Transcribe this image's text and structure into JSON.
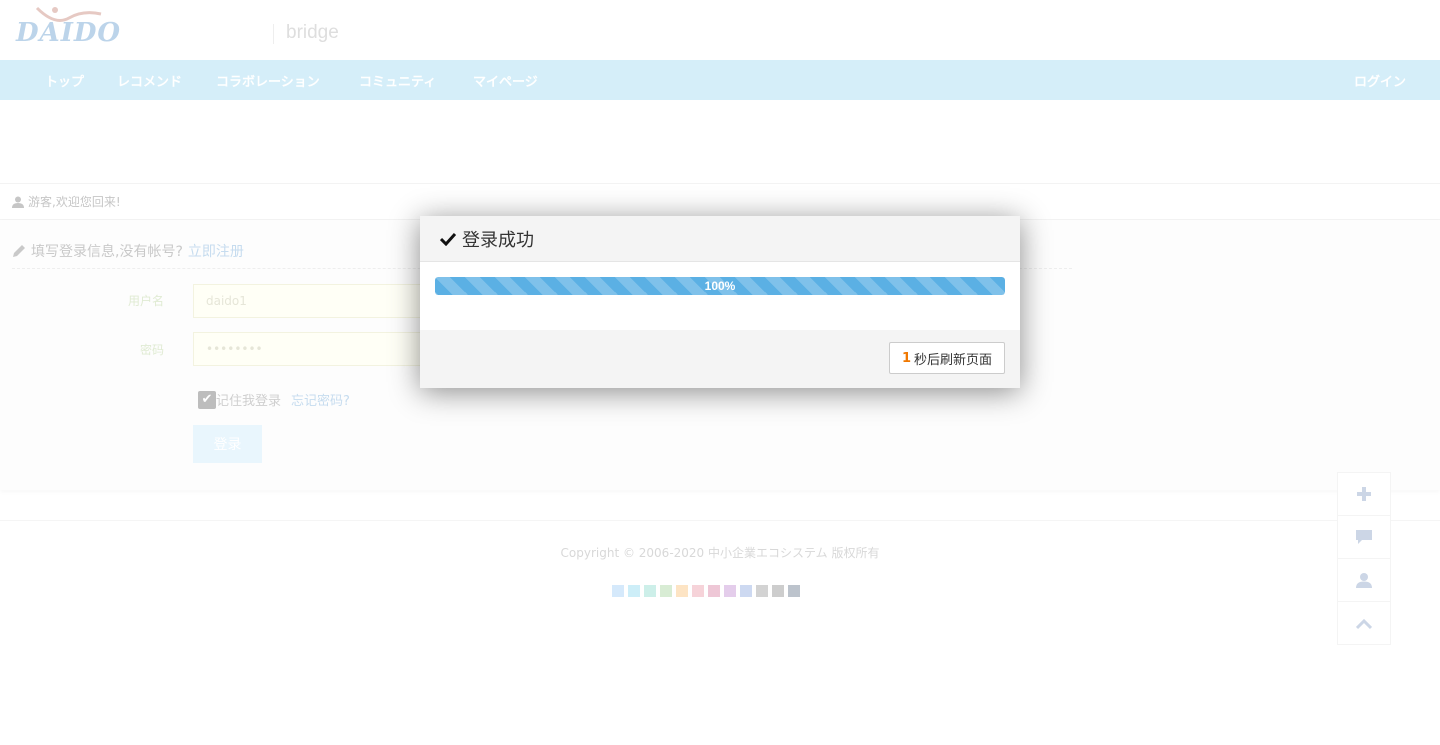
{
  "header": {
    "logo_text": "DAIDO",
    "site_name": "bridge"
  },
  "nav": {
    "items": [
      {
        "label": "トップ"
      },
      {
        "label": "レコメンド"
      },
      {
        "label": "コラボレーション"
      },
      {
        "label": "コミュニティ"
      },
      {
        "label": "マイページ"
      }
    ],
    "login_label": "ログイン"
  },
  "welcome": {
    "text": "游客,欢迎您回来!"
  },
  "form": {
    "title_text": "填写登录信息,没有帐号?",
    "register_link": "立即注册",
    "username_label": "用户名",
    "username_value": "daido1",
    "password_label": "密码",
    "password_value": "••••••••",
    "remember_label": "记住我登录",
    "remember_checked": true,
    "forgot_link": "忘记密码?",
    "submit_label": "登录"
  },
  "footer": {
    "copyright": "Copyright © 2006-2020 中小企業エコシステム 版权所有",
    "theme_swatches": [
      "#d5e9fb",
      "#cdeef8",
      "#cdefe9",
      "#d8ecd4",
      "#fde4c4",
      "#f6d3d9",
      "#eec7d6",
      "#e4cdeb",
      "#cdd9f1",
      "#d3d3d3",
      "#cdcdcd",
      "#bcc3cc"
    ]
  },
  "side_tools": [
    {
      "icon": "plus-icon"
    },
    {
      "icon": "comment-icon"
    },
    {
      "icon": "user-icon"
    },
    {
      "icon": "chevron-up-icon"
    }
  ],
  "modal": {
    "title": "登录成功",
    "progress": 1.0,
    "progress_label": "100%",
    "countdown": "1",
    "refresh_label": "秒后刷新页面"
  },
  "colors": {
    "nav_bg": "#d5eef9",
    "progress": "#5bb0e4",
    "countdown": "#f07800"
  }
}
